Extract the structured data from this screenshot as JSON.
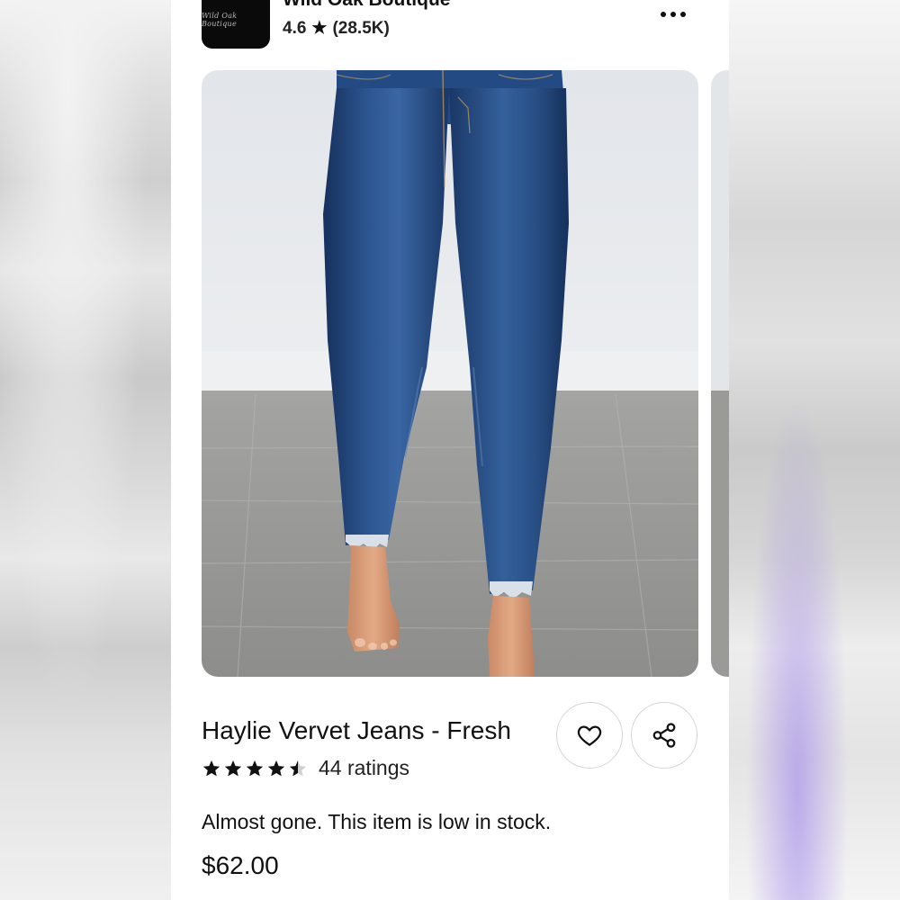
{
  "shop": {
    "logo_text": "Wild Oak Boutique",
    "name": "Wild Oak Boutique",
    "rating": "4.6",
    "review_count": "(28.5K)",
    "star_icon": "star-icon",
    "more_icon": "more-dots-icon"
  },
  "product": {
    "image_alt": "Woman wearing dark wash skinny jeans with distressed hems, standing barefoot on grey wood floor",
    "title": "Haylie Vervet Jeans - Fresh",
    "star_rating": 4.5,
    "ratings_label": "44 ratings",
    "stock_message": "Almost gone. This item is low in stock.",
    "price": "$62.00"
  },
  "actions": {
    "favorite_icon": "heart-icon",
    "share_icon": "share-icon"
  },
  "colors": {
    "text": "#111111",
    "denim": "#1f3f73",
    "wall": "#e4e6ea",
    "floor": "#9c9c9a",
    "accent_blur": "#9678eb"
  }
}
